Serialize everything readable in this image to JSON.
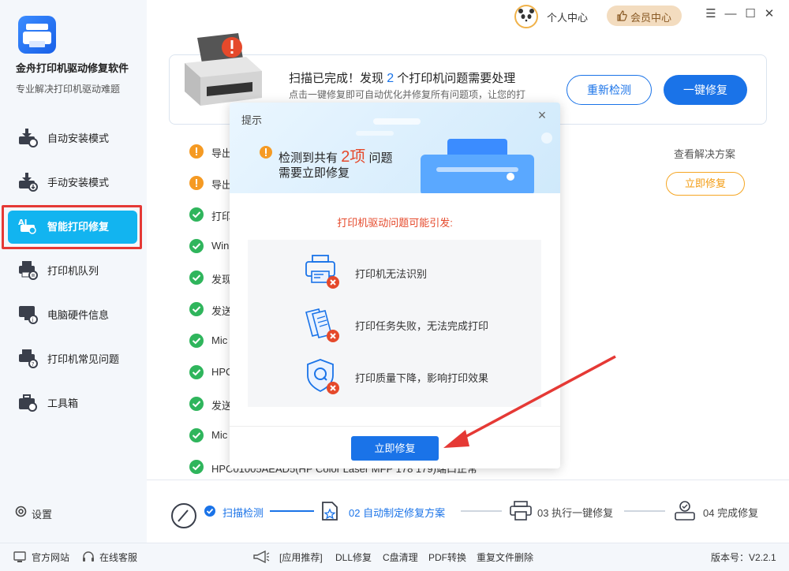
{
  "app": {
    "name": "金舟打印机驱动修复软件",
    "subtitle": "专业解决打印机驱动难题"
  },
  "sidebar": {
    "items": [
      {
        "label": "自动安装模式",
        "icon": "auto-install-icon"
      },
      {
        "label": "手动安装模式",
        "icon": "manual-install-icon"
      },
      {
        "label": "智能打印修复",
        "icon": "ai-repair-icon",
        "active": true
      },
      {
        "label": "打印机队列",
        "icon": "printer-queue-icon"
      },
      {
        "label": "电脑硬件信息",
        "icon": "hardware-info-icon"
      },
      {
        "label": "打印机常见问题",
        "icon": "faq-icon"
      },
      {
        "label": "工具箱",
        "icon": "toolbox-icon"
      }
    ],
    "settings_label": "设置"
  },
  "topbar": {
    "personal_center": "个人中心",
    "vip_center": "会员中心"
  },
  "scan": {
    "title_prefix": "扫描已完成！发现",
    "count": "2",
    "title_suffix": "个打印机问题需要处理",
    "desc": "点击一键修复即可自动优化并修复所有问题项，让您的打",
    "rescan_label": "重新检测",
    "fix_all_label": "一键修复",
    "view_solution": "查看解决方案",
    "fix_now_label": "立即修复"
  },
  "results": [
    {
      "status": "warn",
      "text": "导出"
    },
    {
      "status": "warn",
      "text": "导出"
    },
    {
      "status": "ok",
      "text": "打印"
    },
    {
      "status": "ok",
      "text": "Win"
    },
    {
      "status": "ok",
      "text": "发现"
    },
    {
      "status": "ok",
      "text": "发送"
    },
    {
      "status": "ok",
      "text": "Mic"
    },
    {
      "status": "ok",
      "text": "HPC"
    },
    {
      "status": "ok",
      "text": "发送"
    },
    {
      "status": "ok",
      "text": "Mic"
    },
    {
      "status": "ok",
      "text": "HPC01005AEAD5(HP Color Laser MFP 178 179)端口正常"
    }
  ],
  "steps": [
    {
      "label": "扫描检测",
      "state": "done"
    },
    {
      "label": "02 自动制定修复方案",
      "state": "current"
    },
    {
      "label": "03 执行一键修复",
      "state": "pending"
    },
    {
      "label": "04 完成修复",
      "state": "pending"
    }
  ],
  "footer": {
    "official_site": "官方网站",
    "online_service": "在线客服",
    "recommend": "[应用推荐]",
    "links": [
      "DLL修复",
      "C盘清理",
      "PDF转换",
      "重复文件删除"
    ],
    "version": "版本号：V2.2.1"
  },
  "modal": {
    "title": "提示",
    "line1_prefix": "检测到共有",
    "count": "2项",
    "line1_suffix": "问题",
    "line2": "需要立即修复",
    "subtitle": "打印机驱动问题可能引发:",
    "items": [
      {
        "label": "打印机无法识别",
        "icon": "printer-unrecognized-icon"
      },
      {
        "label": "打印任务失败，无法完成打印",
        "icon": "print-task-failed-icon"
      },
      {
        "label": "打印质量下降，影响打印效果",
        "icon": "print-quality-icon"
      }
    ],
    "fix_now_label": "立即修复"
  },
  "colors": {
    "accent": "#1a73e8",
    "active_nav": "#12b4f0",
    "warning": "#f59a23",
    "ok": "#2fb55c",
    "error": "#e5492b"
  }
}
